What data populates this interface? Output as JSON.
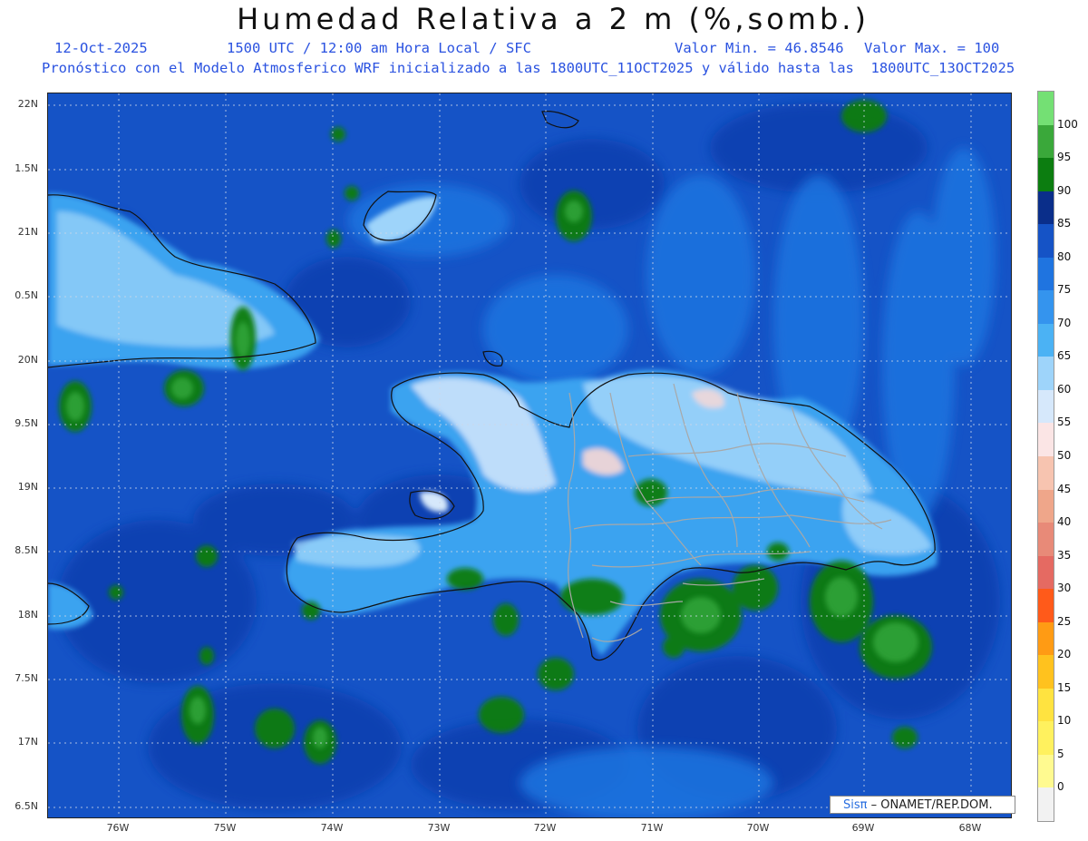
{
  "header": {
    "title": "Humedad Relativa a 2 m (%,somb.)",
    "date": "12-Oct-2025",
    "time_info": "1500 UTC / 12:00 am Hora Local / SFC",
    "value_min": "Valor Min. = 46.8546",
    "value_max": "Valor Max. = 100",
    "forecast_info": "Pronóstico con el Modelo Atmosferico WRF inicializado a las 1800UTC_11OCT2025 y válido hasta las  1800UTC_13OCT2025"
  },
  "map": {
    "lat_labels": [
      "22N",
      "1.5N",
      "21N",
      "0.5N",
      "20N",
      "9.5N",
      "19N",
      "8.5N",
      "18N",
      "7.5N",
      "17N",
      "6.5N"
    ],
    "lon_labels": [
      "76W",
      "75W",
      "74W",
      "73W",
      "72W",
      "71W",
      "70W",
      "69W",
      "68W"
    ],
    "colors": {
      "ocean_deep": "#0b3fb0",
      "ocean": "#1553c6",
      "mid": "#1f74e0",
      "light": "#3aa3f0",
      "pale": "#9ed4fa",
      "paler": "#d6e8fb",
      "pink": "#fbd8d5",
      "green_dark": "#0c7d10",
      "green": "#33a63a"
    }
  },
  "colorbar": {
    "labels": [
      "100",
      "95",
      "90",
      "85",
      "80",
      "75",
      "70",
      "65",
      "60",
      "55",
      "50",
      "45",
      "40",
      "35",
      "30",
      "25",
      "20",
      "15",
      "10",
      "5",
      "0"
    ],
    "colors": [
      "#74e074",
      "#3aa83a",
      "#0c7d10",
      "#0a2e8a",
      "#1553c6",
      "#1f74e0",
      "#3494ee",
      "#4bb2f4",
      "#9ed4fa",
      "#d6e8fb",
      "#fbe5e5",
      "#f7c4b0",
      "#efa68a",
      "#e88a78",
      "#e56a62",
      "#ff5a1a",
      "#ff9b14",
      "#ffc21e",
      "#ffe340",
      "#fff15e",
      "#fffa90",
      "#f2f2f2"
    ]
  },
  "credit": {
    "brand": "Sisπ",
    "text": "– ONAMET/REP.DOM."
  }
}
